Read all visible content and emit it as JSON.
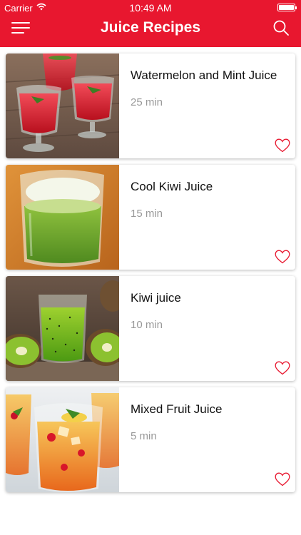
{
  "status_bar": {
    "carrier": "Carrier",
    "time": "10:49 AM",
    "battery_level": 1.0
  },
  "header": {
    "title": "Juice Recipes",
    "menu_icon": "hamburger-menu-icon",
    "search_icon": "search-icon"
  },
  "colors": {
    "brand": "#e8172f",
    "favorite": "#e8172f",
    "time_text": "#999999"
  },
  "recipes": [
    {
      "name": "Watermelon and Mint Juice",
      "time": "25 min",
      "favorite": false
    },
    {
      "name": "Cool Kiwi Juice",
      "time": "15 min",
      "favorite": false
    },
    {
      "name": "Kiwi juice",
      "time": "10 min",
      "favorite": false
    },
    {
      "name": "Mixed Fruit Juice",
      "time": "5 min",
      "favorite": false
    }
  ]
}
